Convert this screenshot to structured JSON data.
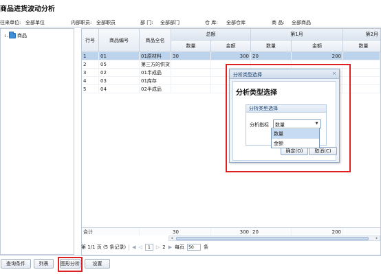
{
  "page": {
    "title": "商品进货波动分析"
  },
  "filters": [
    {
      "label": "往来单位:",
      "value": "全部单位"
    },
    {
      "label": "内部职员:",
      "value": "全部职员"
    },
    {
      "label": "部 门:",
      "value": "全部部门"
    },
    {
      "label": "仓 库:",
      "value": "全部仓库"
    },
    {
      "label": "商 品:",
      "value": "全部商品"
    }
  ],
  "tree": {
    "root_label": "商品"
  },
  "grid": {
    "col_headers": [
      "行号",
      "商品编号",
      "商品全名"
    ],
    "group_headers": [
      "总额",
      "第1月",
      "第2月"
    ],
    "sub_headers": [
      "数量",
      "金额",
      "数量",
      "金额",
      "数量"
    ],
    "rows": [
      {
        "no": "1",
        "code": "01",
        "name": "01原材料",
        "total_qty": "30",
        "total_amt": "300",
        "m1_qty": "20",
        "m1_amt": "200",
        "m2_qty": ""
      },
      {
        "no": "2",
        "code": "05",
        "name": "第三方的供货",
        "total_qty": "",
        "total_amt": "",
        "m1_qty": "",
        "m1_amt": "",
        "m2_qty": ""
      },
      {
        "no": "3",
        "code": "02",
        "name": "01半成品",
        "total_qty": "",
        "total_amt": "",
        "m1_qty": "",
        "m1_amt": "",
        "m2_qty": ""
      },
      {
        "no": "4",
        "code": "03",
        "name": "01库存",
        "total_qty": "",
        "total_amt": "",
        "m1_qty": "",
        "m1_amt": "",
        "m2_qty": ""
      },
      {
        "no": "5",
        "code": "04",
        "name": "02半成品",
        "total_qty": "",
        "total_amt": "",
        "m1_qty": "",
        "m1_amt": "",
        "m2_qty": ""
      }
    ],
    "selected_row": 1,
    "totals": {
      "label": "合计",
      "total_qty": "30",
      "total_amt": "300",
      "m1_qty": "20",
      "m1_amt": "200"
    }
  },
  "pager": {
    "page_info": "第 1/1 页 (5 条记录)",
    "current_page": "1",
    "next_page": "2",
    "page_size_label": "每页",
    "page_size": "50",
    "unit": "条",
    "first_glyph": "◀",
    "prev_glyph": "◁",
    "next_glyph": "▷",
    "last_glyph": "▶"
  },
  "toolbar": {
    "query_label": "查询条件",
    "list_label": "列表",
    "chart_label": "图形分析",
    "settings_label": "设置"
  },
  "dialog": {
    "title": "分析类型选择",
    "close_glyph": "×",
    "heading": "分析类型选择",
    "fieldset_title": "分析类型选择",
    "field_label": "分析指标",
    "selected_value": "数量",
    "options": [
      "数量",
      "金额"
    ],
    "ok_label": "确定(O)",
    "cancel_label": "取消(C)"
  },
  "colors": {
    "highlight": "#e02020",
    "selected_row": "#bcd3ee",
    "folder": "#3f8fd8"
  }
}
